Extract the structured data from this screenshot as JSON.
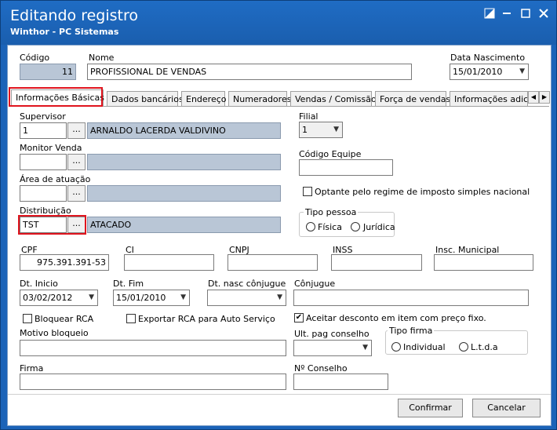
{
  "window": {
    "title": "Editando registro",
    "subtitle": "Winthor - PC Sistemas"
  },
  "header": {
    "codigo_label": "Código",
    "codigo_value": "11",
    "nome_label": "Nome",
    "nome_value": "PROFISSIONAL DE VENDAS",
    "nascimento_label": "Data Nascimento",
    "nascimento_value": "15/01/2010"
  },
  "tabs": [
    {
      "label": "Informações Básicas"
    },
    {
      "label": "Dados bancários"
    },
    {
      "label": "Endereço"
    },
    {
      "label": "Numeradores"
    },
    {
      "label": "Vendas  / Comissão"
    },
    {
      "label": "Força de vendas"
    },
    {
      "label": "Informações adicio"
    }
  ],
  "form": {
    "supervisor_label": "Supervisor",
    "supervisor_code": "1",
    "supervisor_name": "ARNALDO LACERDA VALDIVINO",
    "monitor_label": "Monitor Venda",
    "monitor_code": "",
    "monitor_name": "",
    "area_label": "Área de atuação",
    "area_code": "",
    "area_name": "",
    "distribuicao_label": "Distribuição",
    "distribuicao_code": "TST",
    "distribuicao_name": "ATACADO",
    "ellipsis": "...",
    "filial_label": "Filial",
    "filial_value": "1",
    "codigo_equipe_label": "Código Equipe",
    "codigo_equipe_value": "",
    "optante_label": "Optante pelo regime de imposto simples nacional",
    "tipo_pessoa_label": "Tipo pessoa",
    "fisica_label": "Física",
    "juridica_label": "Jurídica",
    "cpf_label": "CPF",
    "cpf_value": "975.391.391-53",
    "ci_label": "CI",
    "cnpj_label": "CNPJ",
    "inss_label": "INSS",
    "insc_municipal_label": "Insc. Municipal",
    "dt_inicio_label": "Dt. Inicio",
    "dt_inicio_value": "03/02/2012",
    "dt_fim_label": "Dt. Fim",
    "dt_fim_value": "15/01/2010",
    "dt_nasc_conjugue_label": "Dt. nasc cônjugue",
    "dt_nasc_conjugue_value": "",
    "conjugue_label": "Cônjugue",
    "bloquear_rca_label": "Bloquear RCA",
    "exportar_rca_label": "Exportar RCA para Auto Serviço",
    "aceitar_desconto_label": "Aceitar desconto em item com preço fixo.",
    "aceitar_desconto_checked": "✔",
    "motivo_bloqueio_label": "Motivo bloqueio",
    "ult_pag_conselho_label": "Ult. pag conselho",
    "tipo_firma_label": "Tipo firma",
    "individual_label": "Individual",
    "ltda_label": "L.t.d.a",
    "firma_label": "Firma",
    "n_conselho_label": "Nº Conselho"
  },
  "buttons": {
    "confirmar": "Confirmar",
    "cancelar": "Cancelar"
  },
  "colors": {
    "titlebar": "#1b63b8",
    "highlight": "#e0141e",
    "readonly_field": "#b9c6d6"
  }
}
